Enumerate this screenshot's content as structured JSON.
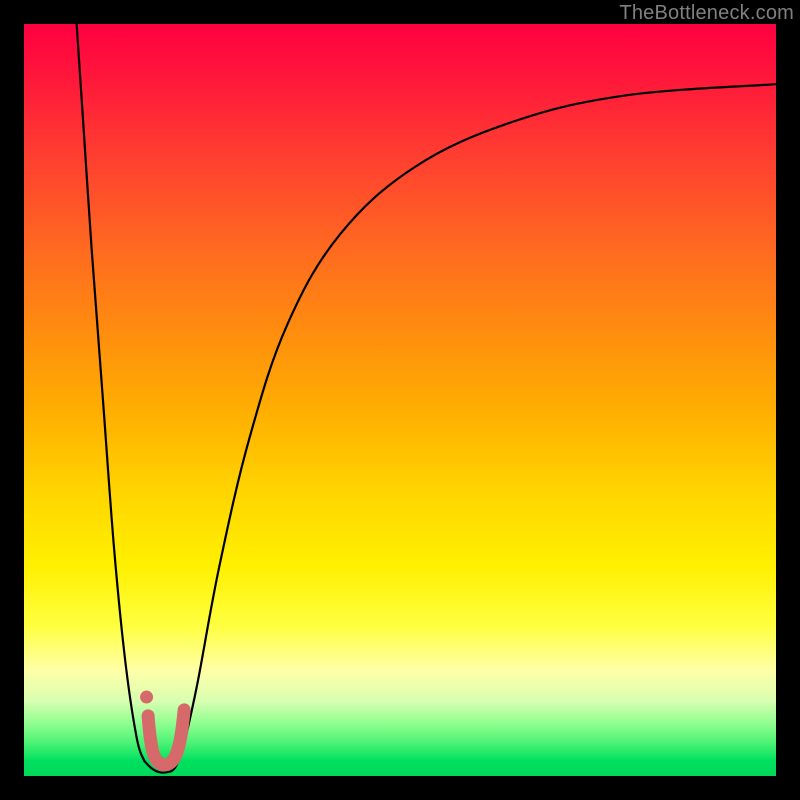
{
  "watermark": "TheBottleneck.com",
  "colors": {
    "frame": "#000000",
    "curve": "#000000",
    "marker_fill": "#d66a6a",
    "marker_stroke": "#b84c4c"
  },
  "chart_data": {
    "type": "line",
    "title": "",
    "xlabel": "",
    "ylabel": "",
    "xlim": [
      0,
      100
    ],
    "ylim": [
      0,
      100
    ],
    "grid": false,
    "legend": false,
    "note": "No axis ticks or numeric labels are rendered; values below are percentage positions read from the image (0,0 = bottom-left of the colored plot area).",
    "series": [
      {
        "name": "left-branch",
        "x": [
          7,
          8,
          9,
          10.5,
          12,
          13.5,
          15,
          16
        ],
        "y": [
          100,
          85,
          70,
          50,
          30,
          15,
          5,
          2
        ]
      },
      {
        "name": "valley",
        "x": [
          16,
          17,
          18,
          19,
          20,
          21
        ],
        "y": [
          2,
          1,
          0.5,
          0.5,
          1,
          3
        ]
      },
      {
        "name": "right-branch",
        "x": [
          21,
          23,
          26,
          30,
          35,
          42,
          52,
          65,
          80,
          100
        ],
        "y": [
          3,
          12,
          28,
          45,
          60,
          72,
          81,
          87,
          90.5,
          92
        ]
      }
    ],
    "markers": {
      "name": "highlighted-range",
      "shape": "J-stroke",
      "points_xy": [
        [
          16.5,
          8
        ],
        [
          16.8,
          5
        ],
        [
          17.3,
          2.7
        ],
        [
          18.2,
          1.6
        ],
        [
          19.2,
          1.6
        ],
        [
          20.0,
          2.4
        ],
        [
          20.6,
          4.0
        ],
        [
          21.0,
          6.2
        ],
        [
          21.3,
          8.8
        ]
      ],
      "dot_xy": [
        16.3,
        10.5
      ]
    }
  }
}
